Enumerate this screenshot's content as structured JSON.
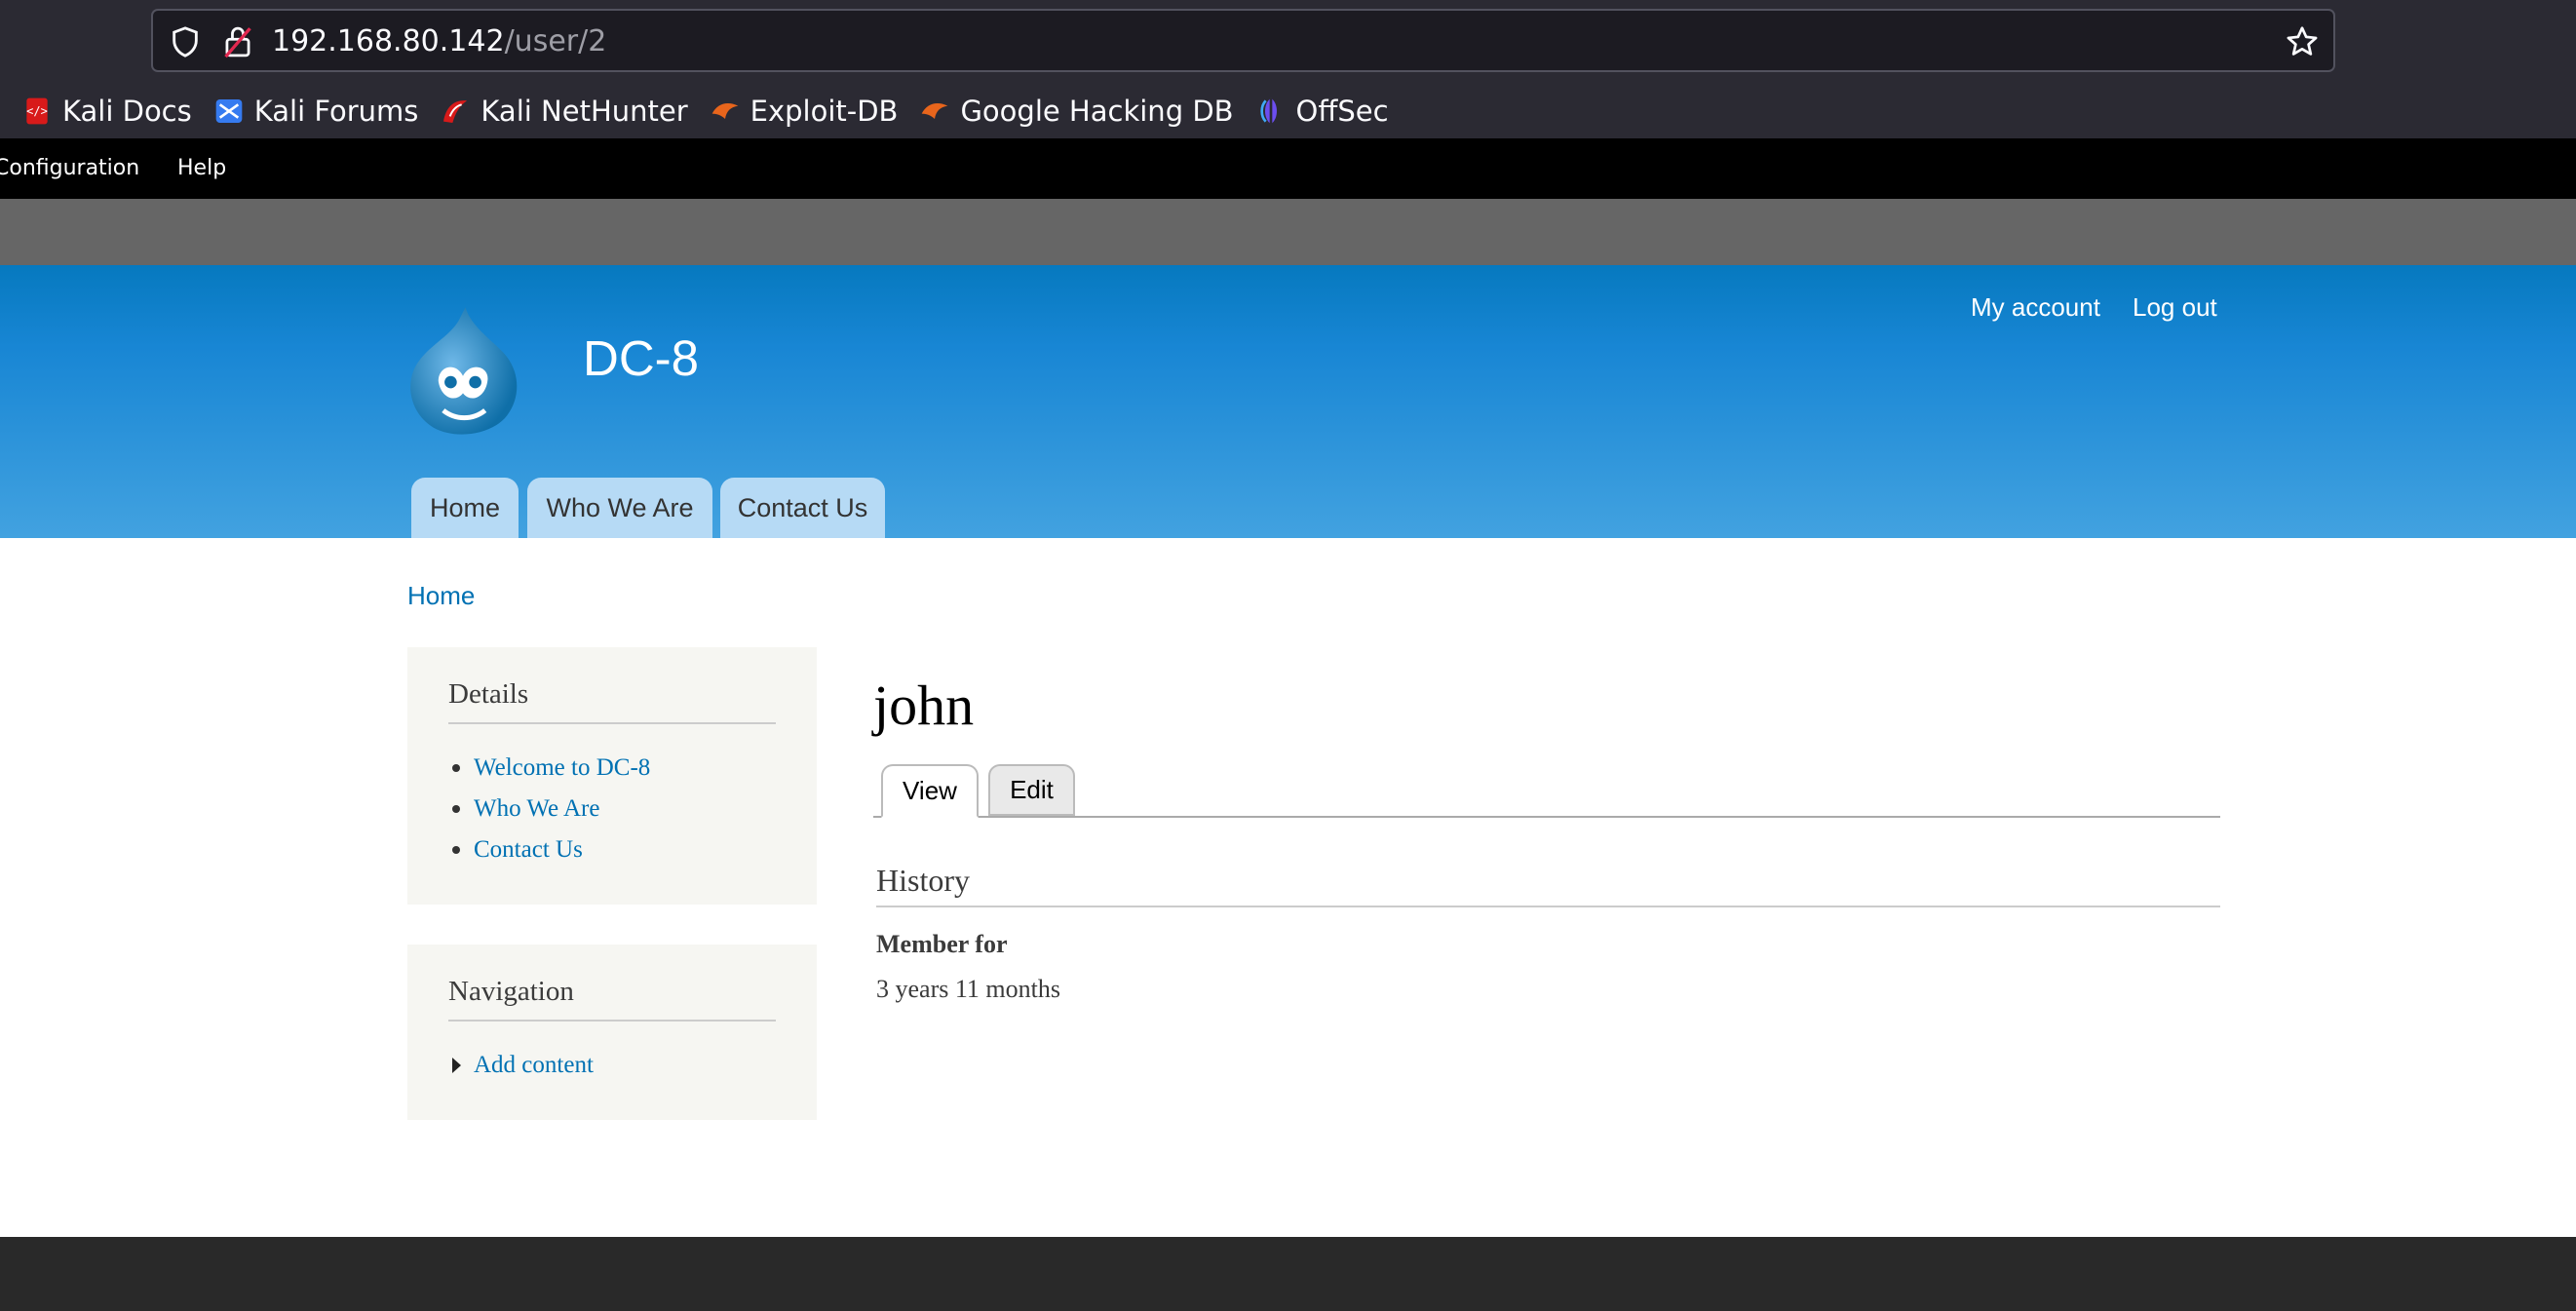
{
  "browser": {
    "url_host": "192.168.80.142",
    "url_path": "/user/2",
    "bookmarks": [
      {
        "label": "Kali Docs",
        "icon": "kali-docs-icon",
        "color": "#d81a1a"
      },
      {
        "label": "Kali Forums",
        "icon": "kali-forums-icon",
        "color": "#367bf0"
      },
      {
        "label": "Kali NetHunter",
        "icon": "kali-nethunter-icon",
        "color": "#d81a1a"
      },
      {
        "label": "Exploit-DB",
        "icon": "exploit-db-icon",
        "color": "#e8651c"
      },
      {
        "label": "Google Hacking DB",
        "icon": "google-hacking-db-icon",
        "color": "#e8651c"
      },
      {
        "label": "OffSec",
        "icon": "offsec-icon",
        "color": "#6c4ef0"
      }
    ]
  },
  "admin_toolbar": {
    "configuration": "Configuration",
    "help": "Help"
  },
  "header": {
    "site_name": "DC-8",
    "my_account": "My account",
    "log_out": "Log out",
    "tabs": [
      "Home",
      "Who We Are",
      "Contact Us"
    ]
  },
  "breadcrumb": "Home",
  "sidebar": {
    "details": {
      "title": "Details",
      "items": [
        "Welcome to DC-8",
        "Who We Are",
        "Contact Us"
      ]
    },
    "navigation": {
      "title": "Navigation",
      "items": [
        "Add content"
      ]
    }
  },
  "main": {
    "title": "john",
    "tabs": [
      "View",
      "Edit"
    ],
    "history_heading": "History",
    "member_for_label": "Member for",
    "member_for_value": "3 years 11 months"
  },
  "colors": {
    "link": "#0071b3",
    "header_top": "#0679bf",
    "header_bottom": "#42a2e0",
    "tab_bg": "#b6daf5"
  }
}
